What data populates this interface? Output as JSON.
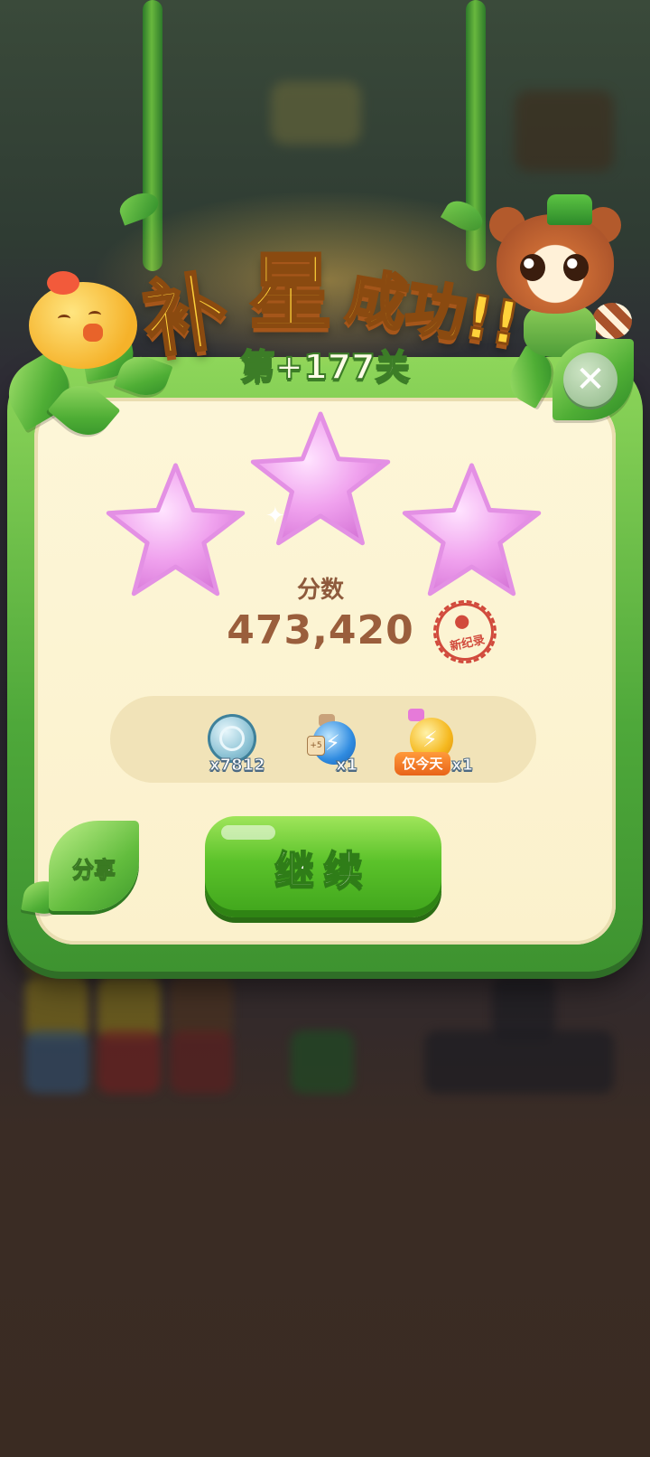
{
  "title": {
    "part1": "补",
    "part2": "星",
    "part3": "成功!!"
  },
  "level_tag": "第+177关",
  "stars": {
    "earned": 3,
    "total": 3,
    "color": "#f2a6f0"
  },
  "score": {
    "label": "分数",
    "value": "473,420",
    "badge_label": "新纪录"
  },
  "rewards": [
    {
      "icon": "coin-icon",
      "count": "x7812"
    },
    {
      "icon": "blue-potion-icon",
      "tag": "+5",
      "count": "x1"
    },
    {
      "icon": "gold-potion-icon",
      "badge": "仅今天",
      "count": "x1"
    }
  ],
  "buttons": {
    "continue_label": "继续",
    "share_label": "分享",
    "close_icon": "close-icon"
  },
  "colors": {
    "accent_green": "#5bc22a",
    "panel_cream": "#fbf1cc",
    "title_gold": "#ffd23a",
    "score_brown": "#9a5e3c",
    "stamp_red": "#d14a3c"
  }
}
